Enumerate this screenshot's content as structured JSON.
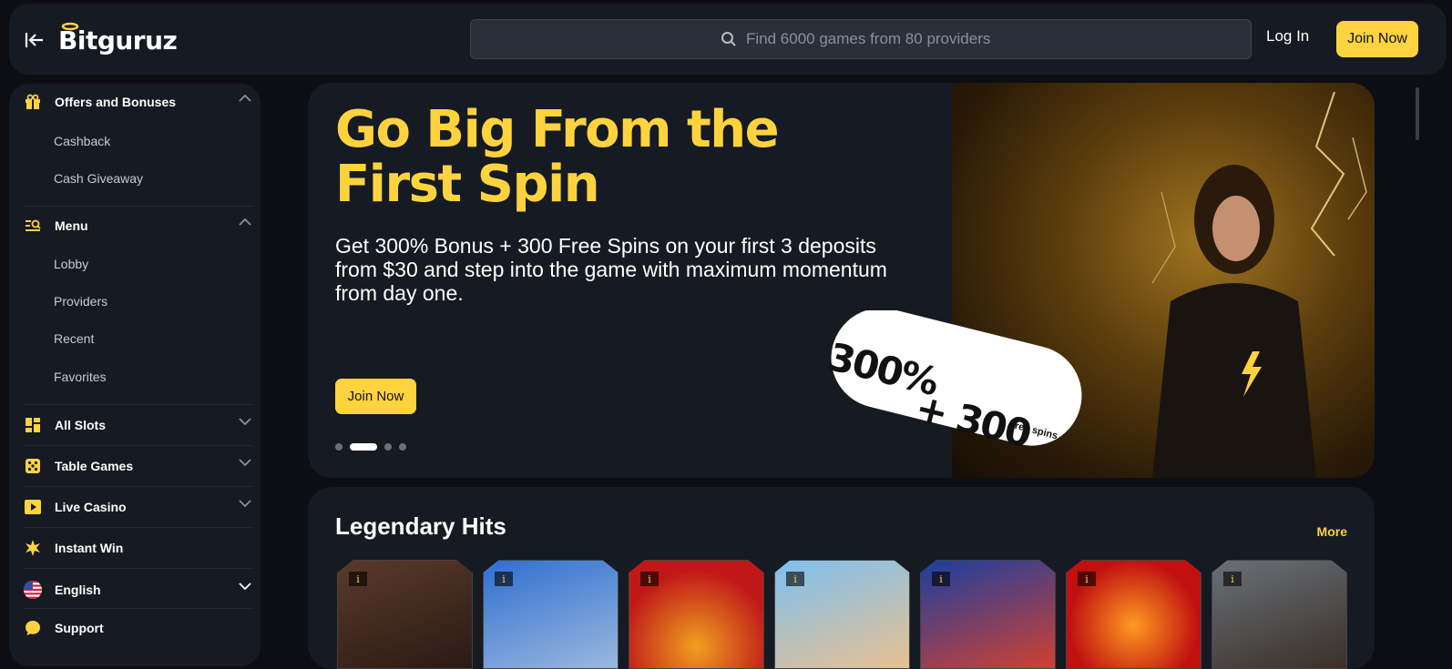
{
  "header": {
    "logo_text": "Bitguruz",
    "search_placeholder": "Find 6000 games from 80 providers",
    "login_label": "Log In",
    "join_label": "Join Now"
  },
  "sidebar": {
    "offers": {
      "label": "Offers and Bonuses",
      "items": [
        "Cashback",
        "Cash Giveaway"
      ]
    },
    "menu": {
      "label": "Menu",
      "items": [
        "Lobby",
        "Providers",
        "Recent",
        "Favorites"
      ]
    },
    "categories": [
      "All Slots",
      "Table Games",
      "Live Casino",
      "Instant Win"
    ],
    "language": "English",
    "support": "Support"
  },
  "hero": {
    "title": "Go Big From the First Spin",
    "subtitle": "Get 300% Bonus + 300 Free Spins on your first 3 deposits from $30 and step into the game with maximum momentum from day one.",
    "join_label": "Join Now",
    "badge_line1": "300%",
    "badge_line2": "+ 300",
    "badge_line3": "free spins",
    "slide_count": 4,
    "active_slide": 2
  },
  "legendary": {
    "title": "Legendary Hits",
    "more_label": "More",
    "card_info_icon": "i"
  },
  "colors": {
    "accent": "#ffd33d",
    "panel": "#161a23",
    "page": "#0c0e14"
  }
}
